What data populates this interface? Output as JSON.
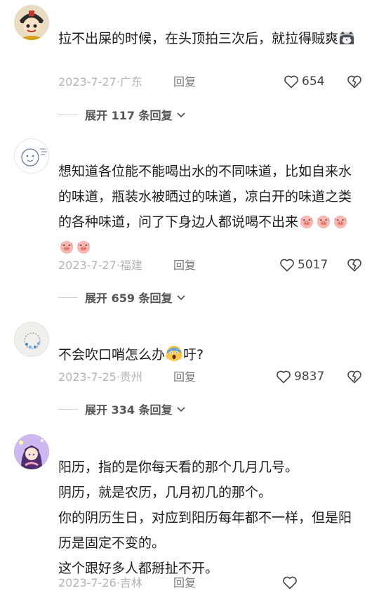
{
  "comments": [
    {
      "text": "拉不出屎的时候，在头顶拍三次后，就拉得贼爽",
      "emoji_suffix": "cat-face-emoji",
      "date": "2023-7-27",
      "location_sep": "·",
      "location": "广东",
      "reply_label": "回复",
      "likes": "654",
      "expand_label": "展开 117 条回复"
    },
    {
      "text": "想知道各位能不能喝出水的不同味道，比如自来水的味道，瓶装水被晒过的味道，凉白开的味道之类的各种味道，问了下身边人都说喝不出来",
      "emoji_suffix": "pig-face-emoji x5",
      "date": "2023-7-27",
      "location_sep": "·",
      "location": "福建",
      "reply_label": "回复",
      "likes": "5017",
      "expand_label": "展开 659 条回复"
    },
    {
      "text_before": "不会吹口哨怎么办",
      "text_after": "吁?",
      "emoji_inline": "screaming-face-emoji",
      "date": "2023-7-25",
      "location_sep": "·",
      "location": "贵州",
      "reply_label": "回复",
      "likes": "9837",
      "expand_label": "展开 334 条回复"
    },
    {
      "text": "阳历，指的是你每天看的那个几月几号。\n阴历，就是农历，几月初几的那个。\n你的阴历生日，对应到阳历每年都不一样，但是阳历是固定不变的。\n这个跟好多人都掰扯不开。",
      "date": "2023-7-26",
      "location_sep": "·",
      "location": "吉林",
      "reply_label": "回复",
      "likes": ""
    }
  ],
  "icons": {
    "like": "heart-outline-icon",
    "dislike": "broken-heart-icon",
    "expand": "chevron-down-icon"
  },
  "colors": {
    "meta_gray": "#b4b4b4",
    "text": "#1c1c1c"
  }
}
